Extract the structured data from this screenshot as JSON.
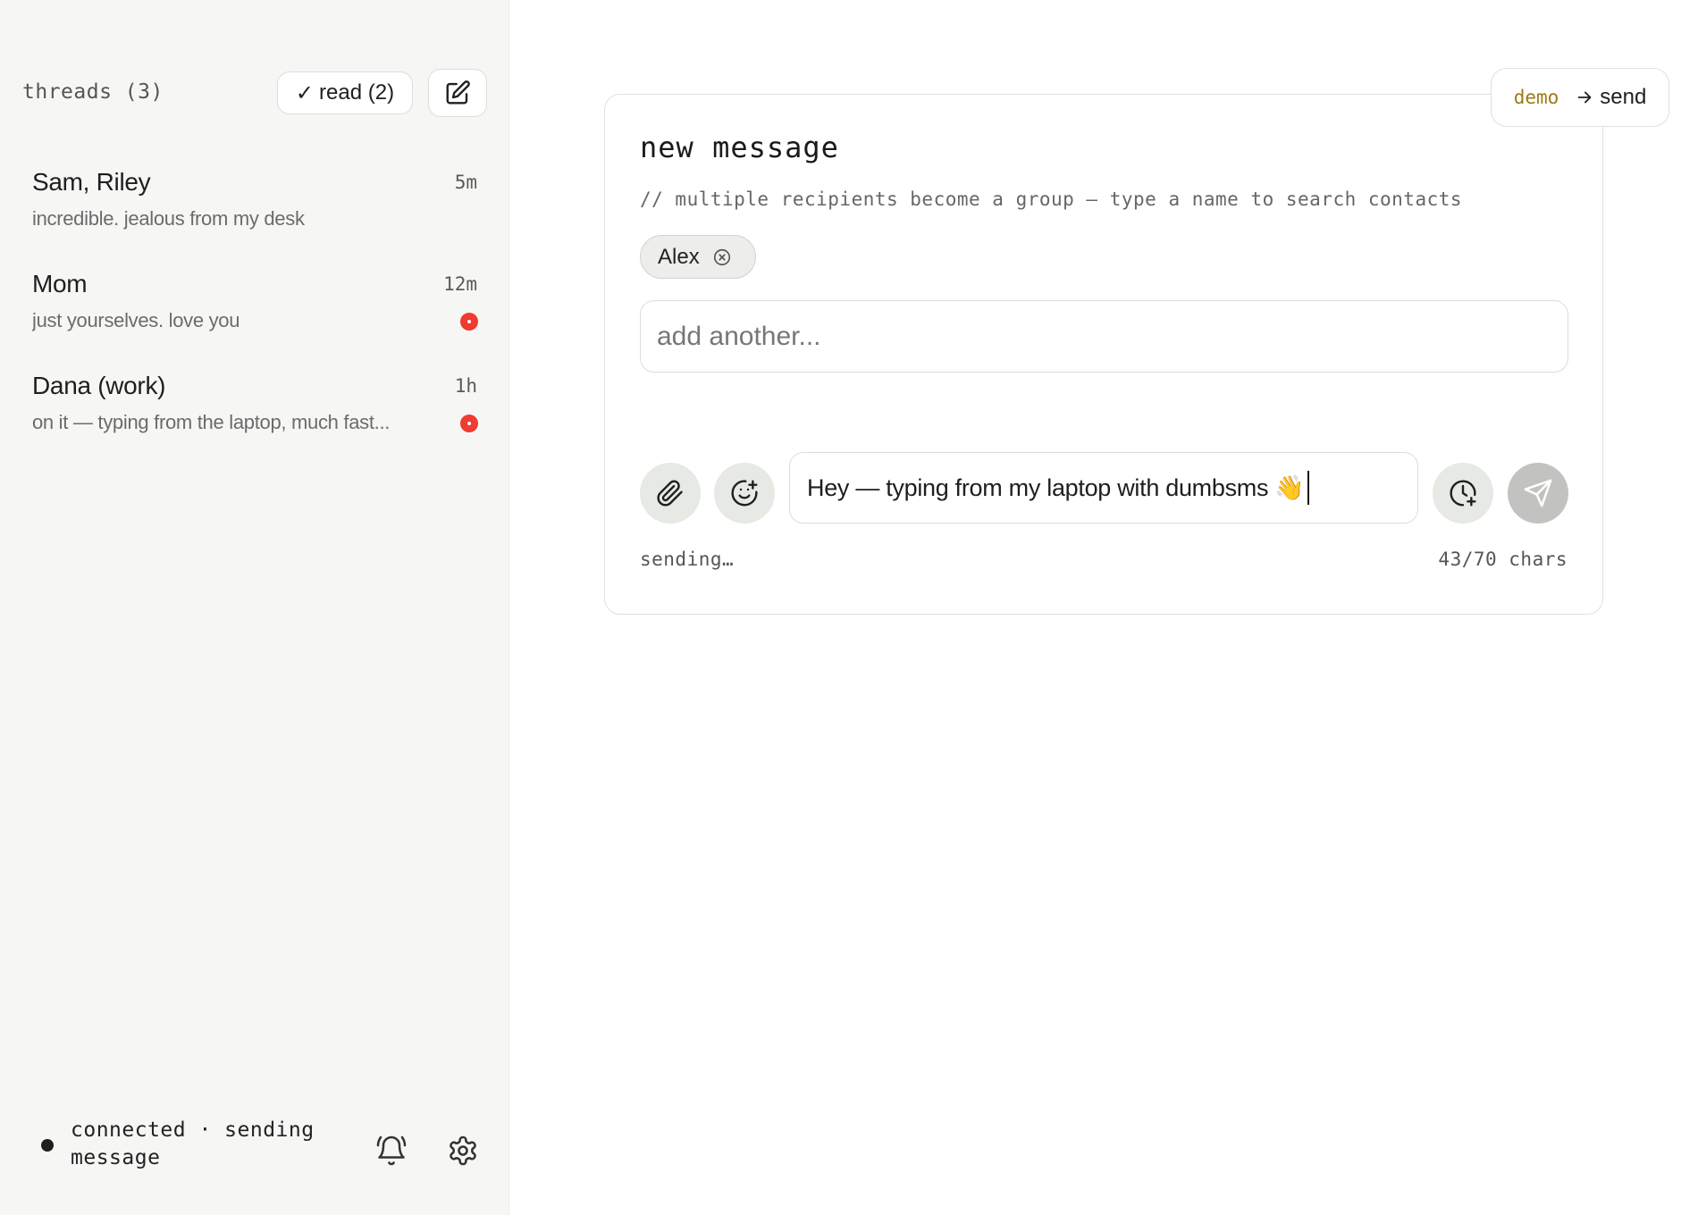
{
  "sidebar": {
    "title": "threads (3)",
    "read_button": "read (2)",
    "threads": [
      {
        "name": "Sam, Riley",
        "time": "5m",
        "preview": "incredible. jealous from my desk",
        "unread": false
      },
      {
        "name": "Mom",
        "time": "12m",
        "preview": "just yourselves. love you",
        "unread": true
      },
      {
        "name": "Dana (work)",
        "time": "1h",
        "preview": "on it — typing from the laptop, much fast...",
        "unread": true
      }
    ],
    "status": "connected · sending message"
  },
  "compose": {
    "title": "new message",
    "hint": "// multiple recipients become a group — type a name to search contacts",
    "recipients": [
      "Alex"
    ],
    "recipient_placeholder": "add another...",
    "message_text": "Hey — typing from my laptop with dumbsms 👋",
    "status": "sending…",
    "char_count": "43/70 chars"
  },
  "demo": {
    "tag": "demo",
    "action": "send"
  },
  "colors": {
    "sidebar_bg": "#f6f7f5",
    "unread_dot": "#ef3b30",
    "demo_tag": "#a07818",
    "send_button_disabled": "#c2c2c0"
  }
}
